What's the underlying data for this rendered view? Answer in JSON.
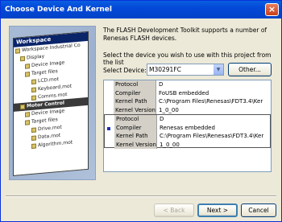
{
  "window": {
    "title": "Choose Device And Kernel",
    "close_glyph": "×"
  },
  "illustration": {
    "workspace_title": "Workspace",
    "tree": [
      "Workspace Industrial Co",
      "Display",
      "Device Image",
      "Target files",
      "LCD.mot",
      "Keyboard.mot",
      "Comms.mot",
      "Motor Control",
      "Device Image",
      "Target files",
      "Drive.mot",
      "Data.mot",
      "Algorithm.mot"
    ]
  },
  "description": "The FLASH Development Toolkit supports a number of Renesas FLASH devices.",
  "prompt": "Select the device you wish to use with this project from the list",
  "device_select": {
    "label": "Select Device:",
    "value": "M30291FC",
    "other_label": "Other..."
  },
  "devices": [
    {
      "protocol": "D",
      "compiler": "FoUSB embedded",
      "kernel_path": "C:\\Program Files\\Renesas\\FDT3.4\\Ker",
      "kernel_version": "1_0_00"
    },
    {
      "protocol": "D",
      "compiler": "Renesas embedded",
      "kernel_path": "C:\\Program Files\\Renesas\\FDT3.4\\Ker",
      "kernel_version": "1_0_00"
    }
  ],
  "row_labels": {
    "protocol": "Protocol",
    "compiler": "Compiler",
    "kernel_path": "Kernel Path",
    "kernel_version": "Kernel Version"
  },
  "buttons": {
    "back": "< Back",
    "next": "Next >",
    "cancel": "Cancel"
  }
}
